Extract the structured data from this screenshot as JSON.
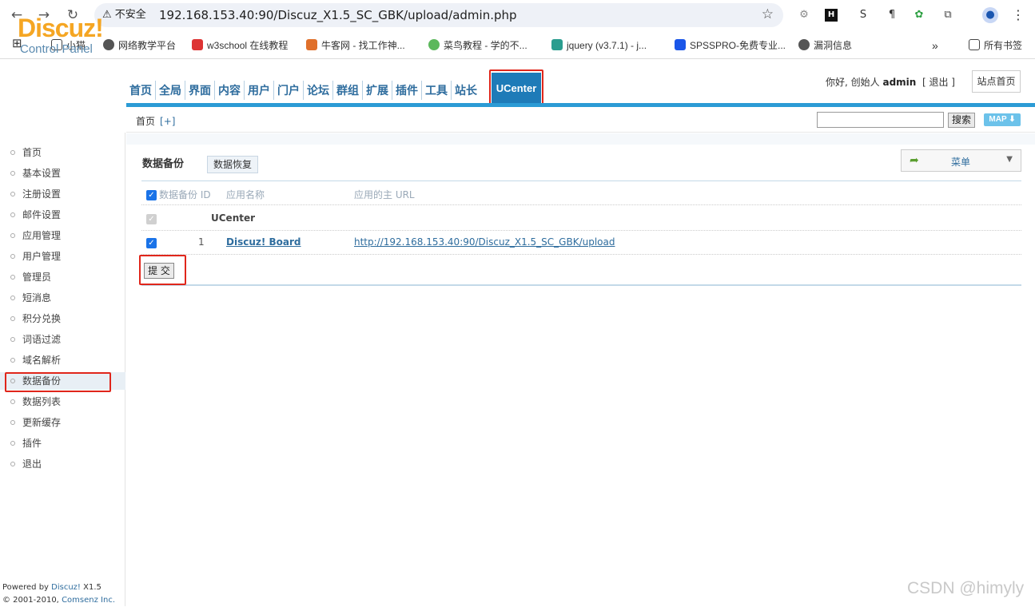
{
  "browser": {
    "security_label": "不安全",
    "url": "192.168.153.40:90/Discuz_X1.5_SC_GBK/upload/admin.php",
    "bookmarks": [
      "小猫",
      "网络教学平台",
      "w3school 在线教程",
      "牛客网 - 找工作神...",
      "菜鸟教程 - 学的不...",
      "jquery (v3.7.1) - j...",
      "SPSSPRO-免费专业...",
      "漏洞信息",
      "所有书签"
    ],
    "icons": [
      "back-arrow-icon",
      "forward-arrow-icon",
      "reload-icon",
      "warning-icon",
      "star-icon",
      "apps-grid-icon",
      "folder-icon",
      "menu-dots-icon",
      "chevron-right-icon"
    ]
  },
  "app": {
    "logo": "Discuz!",
    "logo_sub": "Control Panel",
    "topnav": [
      "首页",
      "全局",
      "界面",
      "内容",
      "用户",
      "门户",
      "论坛",
      "群组",
      "扩展",
      "插件",
      "工具",
      "站长"
    ],
    "active_tab": "UCenter",
    "greeting_prefix": "你好, 创始人",
    "username": "admin",
    "logout": "[ 退出 ]",
    "site_home": "站点首页",
    "accent_color": "#2b9bd5",
    "logo_color": "#f5a623"
  },
  "subhead": {
    "breadcrumb": "首页",
    "add": "[+]",
    "search_value": "",
    "search_button": "搜索",
    "map_button": "MAP ⬇"
  },
  "sidebar": {
    "items": [
      "首页",
      "基本设置",
      "注册设置",
      "邮件设置",
      "应用管理",
      "用户管理",
      "管理员",
      "短消息",
      "积分兑换",
      "词语过滤",
      "域名解析",
      "数据备份",
      "数据列表",
      "更新缓存",
      "插件",
      "退出"
    ],
    "active": "数据备份",
    "footer_powered": "Powered by",
    "footer_product": "Discuz!",
    "footer_version": "X1.5",
    "footer_copy": "© 2001-2010,",
    "footer_company": "Comsenz Inc."
  },
  "main": {
    "title": "数据备份",
    "restore_tab": "数据恢复",
    "menu_button": "菜单",
    "columns": [
      "数据备份 ID",
      "应用名称",
      "应用的主 URL"
    ],
    "group": "UCenter",
    "rows": [
      {
        "id": "1",
        "name": "Discuz! Board",
        "url": "http://192.168.153.40:90/Discuz_X1.5_SC_GBK/upload"
      }
    ],
    "submit": "提 交"
  },
  "watermark": "CSDN @himyly"
}
